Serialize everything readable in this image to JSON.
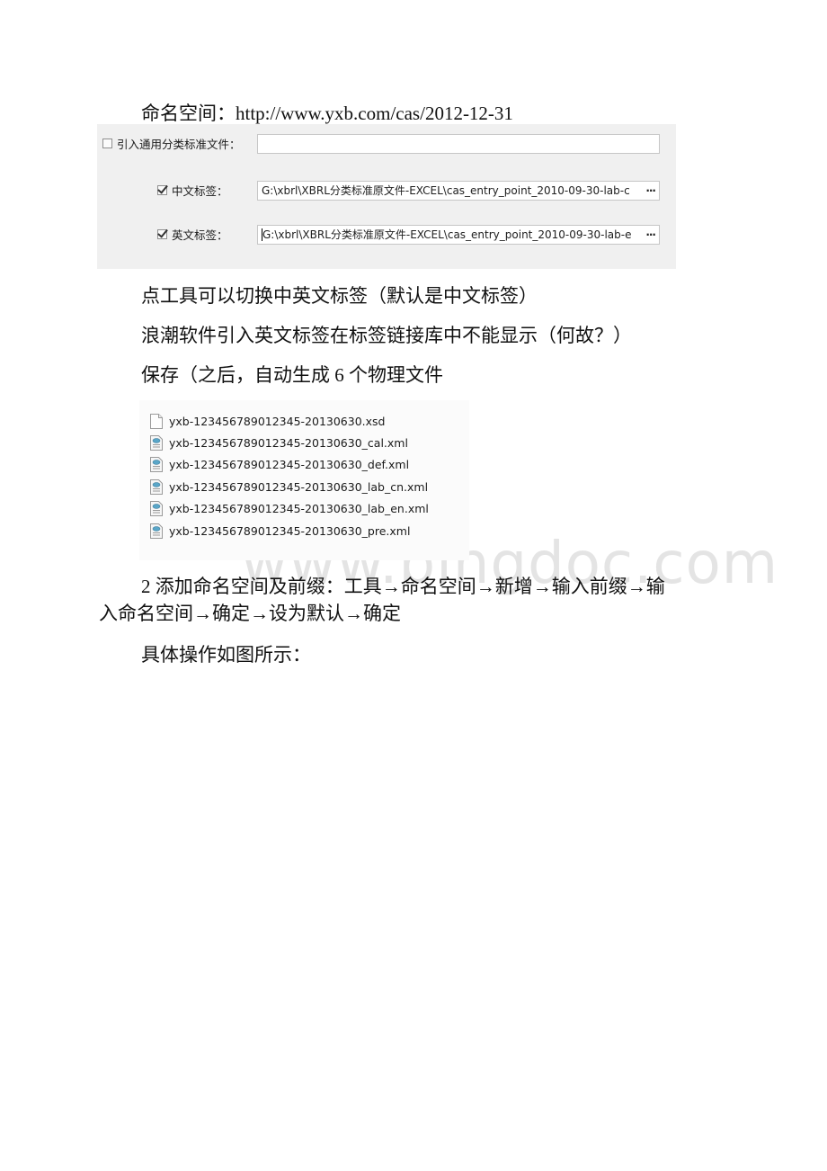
{
  "document": {
    "namespace_line": "命名空间：http://www.yxb.com/cas/2012-12-31",
    "panel": {
      "import_general": {
        "label": "引入通用分类标准文件：",
        "checked": false,
        "value": ""
      },
      "chinese_label": {
        "label": "中文标签：",
        "checked": true,
        "value": "G:\\xbrl\\XBRL分类标准原文件-EXCEL\\cas_entry_point_2010-09-30-lab-c",
        "browse": "···"
      },
      "english_label": {
        "label": "英文标签：",
        "checked": true,
        "value": "G:\\xbrl\\XBRL分类标准原文件-EXCEL\\cas_entry_point_2010-09-30-lab-e",
        "browse": "···"
      }
    },
    "para_toggle": "点工具可以切换中英文标签（默认是中文标签）",
    "para_question": "浪潮软件引入英文标签在标签链接库中不能显示（何故？）",
    "para_save": "保存（之后，自动生成 6 个物理文件",
    "files": [
      {
        "name": "yxb-123456789012345-20130630.xsd",
        "icon": "blank-file-icon"
      },
      {
        "name": "yxb-123456789012345-20130630_cal.xml",
        "icon": "xml-file-icon"
      },
      {
        "name": "yxb-123456789012345-20130630_def.xml",
        "icon": "xml-file-icon"
      },
      {
        "name": "yxb-123456789012345-20130630_lab_cn.xml",
        "icon": "xml-file-icon"
      },
      {
        "name": "yxb-123456789012345-20130630_lab_en.xml",
        "icon": "xml-file-icon"
      },
      {
        "name": "yxb-123456789012345-20130630_pre.xml",
        "icon": "xml-file-icon"
      }
    ],
    "step2_line1": "2 添加命名空间及前缀：工具→命名空间→新增→输入前缀→输",
    "step2_line2": "入命名空间→确定→设为默认→确定",
    "para_howto": "具体操作如图所示：",
    "watermark": "www.bingdoc.com"
  }
}
